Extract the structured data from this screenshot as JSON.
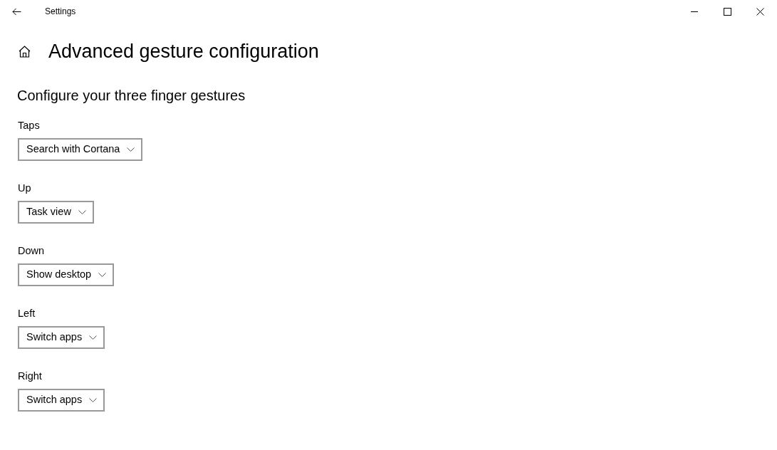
{
  "window": {
    "title": "Settings"
  },
  "page": {
    "title": "Advanced gesture configuration"
  },
  "section": {
    "heading": "Configure your three finger gestures"
  },
  "gestures": [
    {
      "label": "Taps",
      "value": "Search with Cortana"
    },
    {
      "label": "Up",
      "value": "Task view"
    },
    {
      "label": "Down",
      "value": "Show desktop"
    },
    {
      "label": "Left",
      "value": "Switch apps"
    },
    {
      "label": "Right",
      "value": "Switch apps"
    }
  ]
}
